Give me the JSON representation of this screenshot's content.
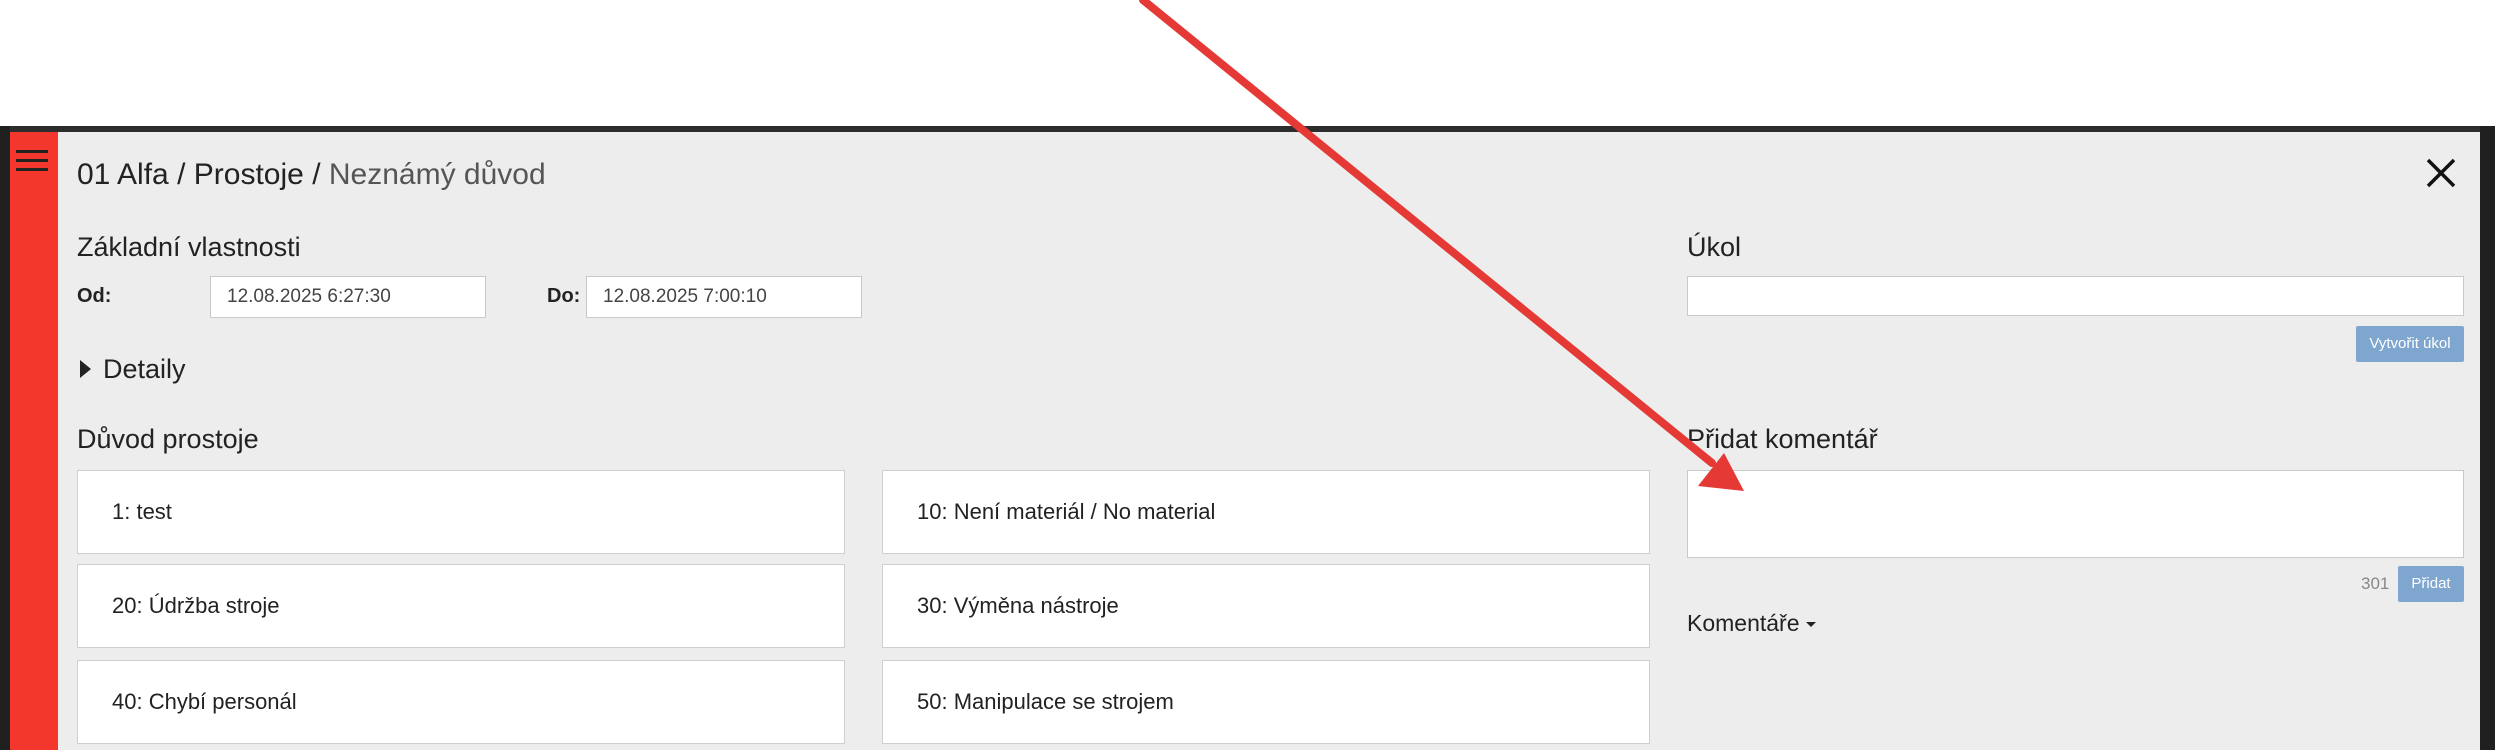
{
  "header": {
    "breadcrumb_line": "01 Alfa",
    "breadcrumb_section": "Prostoje",
    "separator": "/",
    "current": "Neznámý důvod"
  },
  "basic": {
    "heading": "Základní vlastnosti",
    "from_label": "Od:",
    "from_value": "12.08.2025 6:27:30",
    "to_label": "Do:",
    "to_value": "12.08.2025 7:00:10"
  },
  "details": {
    "label": "Detaily"
  },
  "reasons": {
    "heading": "Důvod prostoje",
    "items": [
      "1: test",
      "10: Není materiál / No material",
      "20: Údržba stroje",
      "30: Výměna nástroje",
      "40: Chybí personál",
      "50: Manipulace se strojem"
    ]
  },
  "task": {
    "heading": "Úkol",
    "value": "",
    "create_label": "Vytvořit úkol"
  },
  "comment": {
    "heading": "Přidat komentář",
    "counter": "301",
    "add_label": "Přidat",
    "list_label": "Komentáře"
  },
  "colors": {
    "accent_red": "#f4372c",
    "button_blue": "#7ea6cf",
    "dialog_bg": "#ededed",
    "arrow": "#e53935"
  },
  "icons": [
    "menu-icon",
    "close-icon",
    "caret-right-icon",
    "caret-down-icon"
  ]
}
